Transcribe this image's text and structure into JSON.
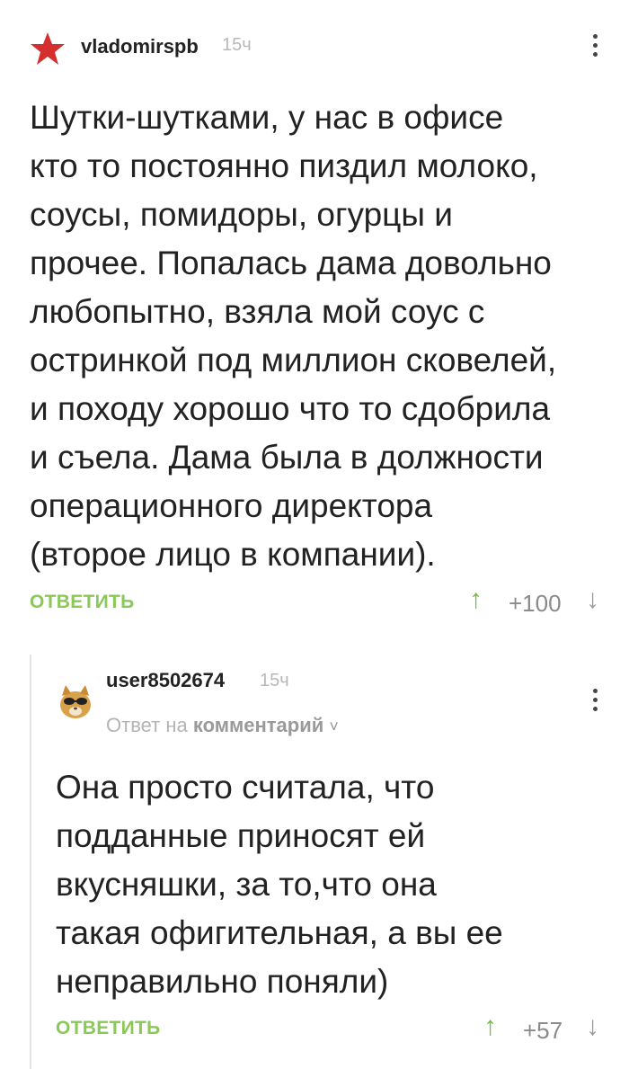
{
  "comment1": {
    "username": "vladomirspb",
    "time": "15ч",
    "text_lines": [
      "Шутки-шутками, у нас в офисе",
      "кто то постоянно пиздил молоко,",
      "соусы, помидоры, огурцы и",
      "прочее. Попалась дама довольно",
      "любопытно, взяла мой соус с",
      "остринкой под миллион сковелей,",
      "и походу хорошо что то сдобрила",
      "и съела. Дама была в должности",
      "операционного директора",
      "(второе лицо в компании)."
    ],
    "reply_label": "ОТВЕТИТЬ",
    "rating": "+100",
    "avatar_icon": "red-star-icon"
  },
  "comment2": {
    "username": "user8502674",
    "time": "15ч",
    "reply_to_prefix": "Ответ на",
    "reply_to_target": "комментарий",
    "text_lines": [
      "Она просто считала, что",
      "подданные приносят ей",
      "вкусняшки, за то,что она",
      "такая офигительная, а вы ее",
      "неправильно поняли)"
    ],
    "reply_label": "ОТВЕТИТЬ",
    "rating": "+57",
    "avatar_icon": "cat-sunglasses-icon"
  },
  "icons": {
    "up": "↑",
    "down": "↓",
    "chevron": "˅"
  },
  "colors": {
    "accent_green": "#8ac858",
    "upvote_green": "#6fbf3a",
    "star_red": "#d32f2f"
  }
}
